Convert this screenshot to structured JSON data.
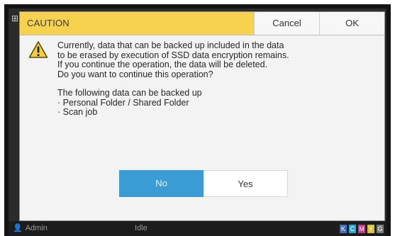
{
  "dialog": {
    "title": "CAUTION",
    "cancel_label": "Cancel",
    "ok_label": "OK",
    "icon": "warning-icon",
    "message_lines": [
      "Currently, data that can be backed up included in the data",
      "to be erased by execution of SSD data encryption remains.",
      "If you continue the operation, the data will be deleted.",
      "Do you want to continue this operation?"
    ],
    "backup_heading": "The following data can be backed up",
    "backup_items": [
      "· Personal Folder / Shared Folder",
      "· Scan job"
    ],
    "no_label": "No",
    "yes_label": "Yes",
    "colors": {
      "title_bg": "#f6d24f",
      "no_button_bg": "#3b9bd4"
    }
  },
  "status": {
    "user": "Admin",
    "state": "Idle",
    "inks": [
      "K",
      "C",
      "M",
      "Y",
      "G"
    ]
  }
}
